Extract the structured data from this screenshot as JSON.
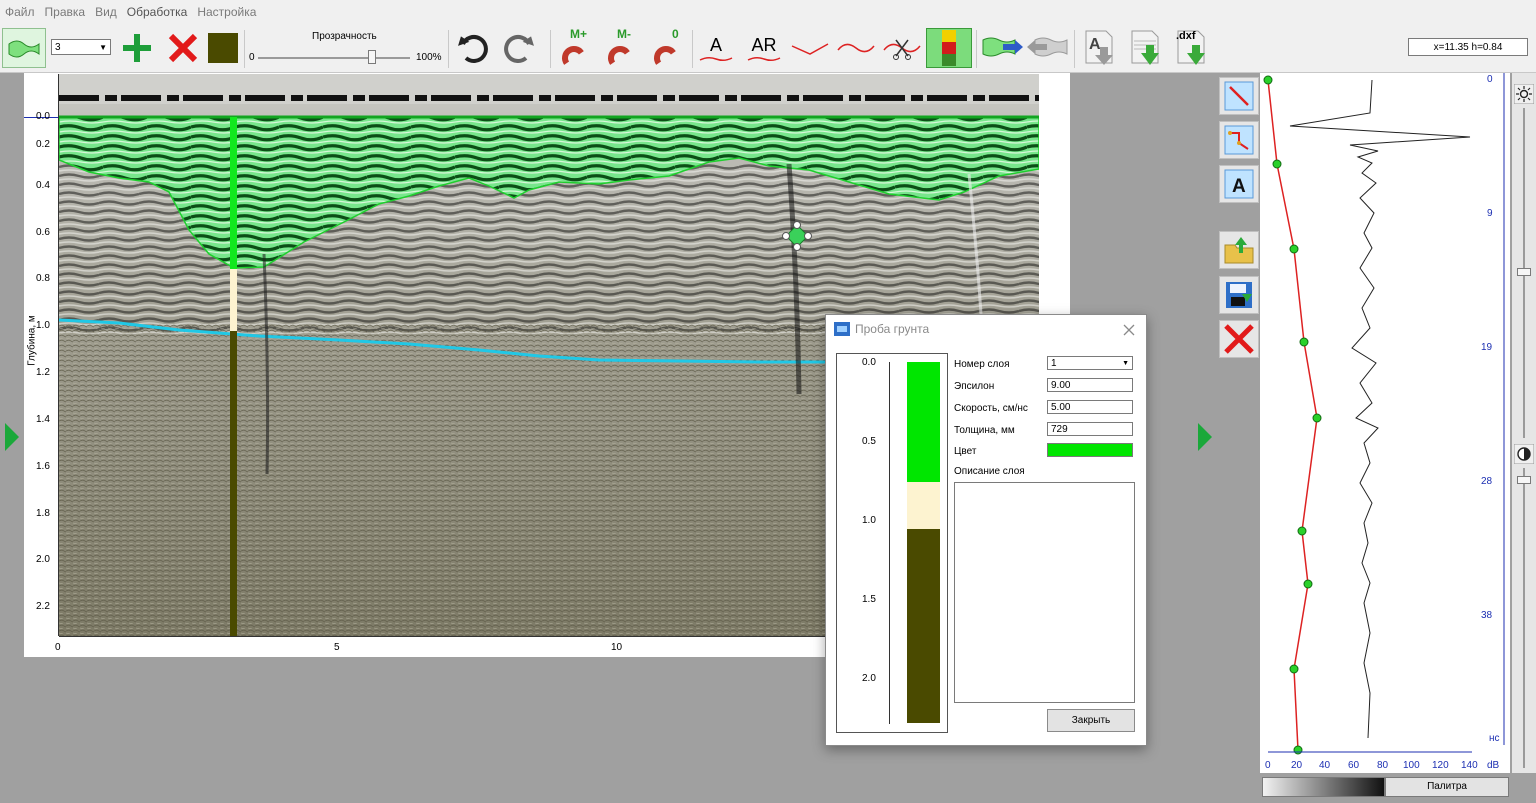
{
  "menu": [
    "Файл",
    "Правка",
    "Вид",
    "Обработка",
    "Настройка"
  ],
  "toolbar": {
    "layer_select": "3",
    "transparency_label": "Прозрачность",
    "slider_min": "0",
    "slider_max": "100%",
    "magnet_plus": "M+",
    "magnet_minus": "M-",
    "magnet_zero": "0",
    "text_tool_a": "A",
    "text_tool_ar": "AR",
    "dxf_label": ".dxf",
    "coordinates": "x=11.35 h=0.84",
    "layer_color": "#4a4a00"
  },
  "radar": {
    "y_axis_label": "Глубина, м",
    "y_ticks": [
      "0.0",
      "0.2",
      "0.4",
      "0.6",
      "0.8",
      "1.0",
      "1.2",
      "1.4",
      "1.6",
      "1.8",
      "2.0",
      "2.2"
    ],
    "x_ticks": [
      "0",
      "5",
      "10"
    ]
  },
  "dialog": {
    "title": "Проба грунта",
    "column_ticks": [
      "0.0",
      "0.5",
      "1.0",
      "1.5",
      "2.0"
    ],
    "layer_number_label": "Номер слоя",
    "layer_number_value": "1",
    "epsilon_label": "Эпсилон",
    "epsilon_value": "9.00",
    "velocity_label": "Скорость, см/нс",
    "velocity_value": "5.00",
    "thickness_label": "Толщина, мм",
    "thickness_value": "729",
    "color_label": "Цвет",
    "color_value": "#00e600",
    "description_label": "Описание слоя",
    "description_value": "",
    "close_button": "Закрыть",
    "layers": [
      {
        "name": "layer-1",
        "from": 0.0,
        "to": 0.76,
        "color": "#00e600"
      },
      {
        "name": "layer-2",
        "from": 0.76,
        "to": 1.06,
        "color": "#fdf3d0"
      },
      {
        "name": "layer-3",
        "from": 1.06,
        "to": 2.3,
        "color": "#4a4a00"
      }
    ]
  },
  "trace": {
    "right_ticks": [
      "0",
      "9",
      "19",
      "28",
      "38",
      "нс"
    ],
    "bottom_ticks": [
      "0",
      "20",
      "40",
      "60",
      "80",
      "100",
      "120",
      "140",
      "dB"
    ],
    "palette_button": "Палитра"
  }
}
